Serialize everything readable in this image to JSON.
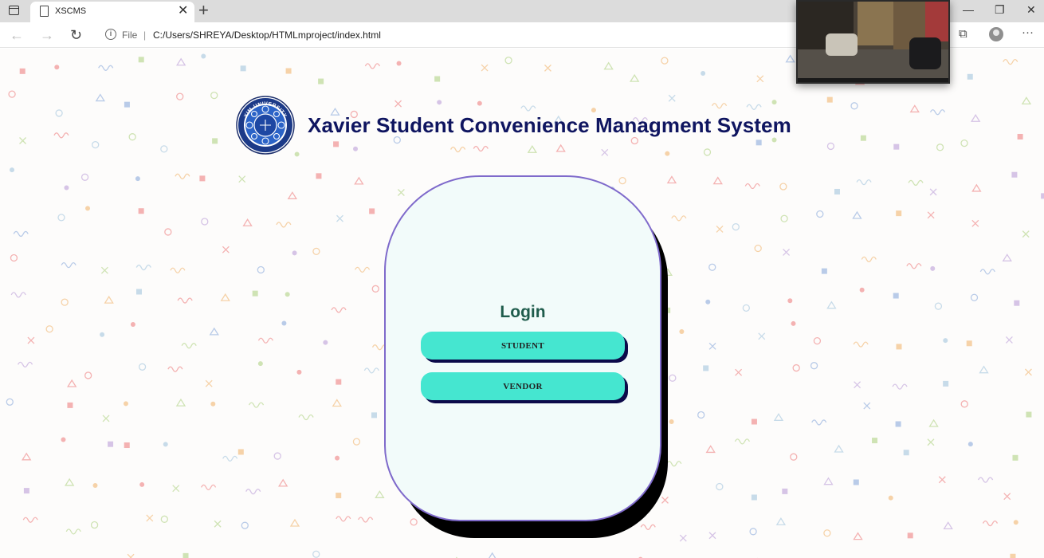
{
  "browser": {
    "tab_title": "XSCMS",
    "tab_close": "✕",
    "new_tab": "+",
    "url_scheme_label": "File",
    "url_separator": "|",
    "url": "C:/Users/SHREYA/Desktop/HTMLmproject/index.html",
    "win_minimize": "—",
    "win_restore": "❐",
    "win_close": "✕",
    "menu": "···"
  },
  "page": {
    "title": "Xavier Student Convenience Managment System",
    "logo_text": "XIM UNIVERSITY",
    "login": {
      "heading": "Login",
      "student_label": "STUDENT",
      "vendor_label": "VENDOR"
    }
  },
  "colors": {
    "title": "#0f1560",
    "card_border": "#7f6acb",
    "button_face": "#45e6d0",
    "button_shadow": "#0c0a4a",
    "login_heading": "#1f5c4c"
  }
}
